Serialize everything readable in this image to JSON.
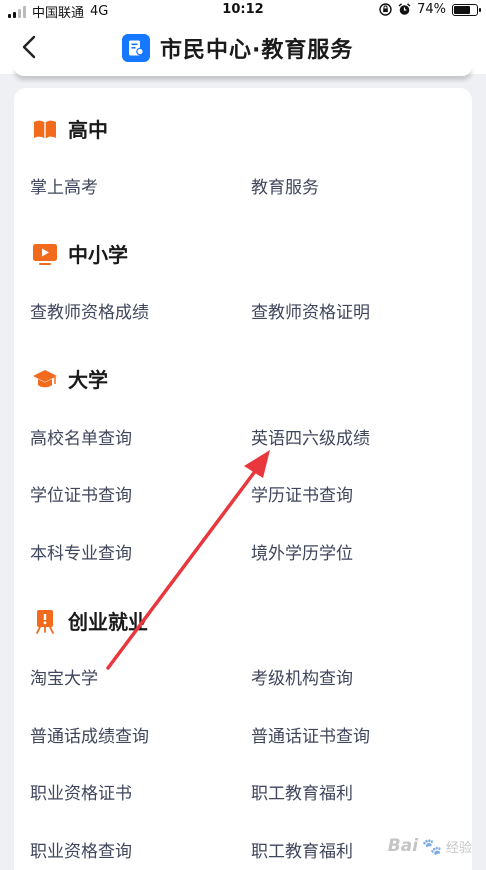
{
  "status_bar": {
    "carrier": "中国联通",
    "network": "4G",
    "time": "10:12",
    "battery": "74%",
    "battery_level": 0.74
  },
  "nav": {
    "title": "市民中心·教育服务"
  },
  "sections": [
    {
      "title": "高中",
      "icon": "book-icon",
      "links": [
        "掌上高考",
        "教育服务"
      ]
    },
    {
      "title": "中小学",
      "icon": "video-play-icon",
      "links": [
        "查教师资格成绩",
        "查教师资格证明"
      ]
    },
    {
      "title": "大学",
      "icon": "graduation-cap-icon",
      "links": [
        "高校名单查询",
        "英语四六级成绩",
        "学位证书查询",
        "学历证书查询",
        "本科专业查询",
        "境外学历学位"
      ]
    },
    {
      "title": "创业就业",
      "icon": "presentation-board-icon",
      "links": [
        "淘宝大学",
        "考级机构查询",
        "普通话成绩查询",
        "普通话证书查询",
        "职业资格证书",
        "职工教育福利",
        "职业资格查询",
        "职工教育福利"
      ]
    }
  ],
  "annotation": {
    "arrow_color": "#e8383d"
  },
  "watermark": {
    "text": "Bai",
    "suffix": "经验"
  },
  "colors": {
    "accent": "#1677ff",
    "section_icon": "#f26b1d",
    "link_text": "#40465c"
  }
}
